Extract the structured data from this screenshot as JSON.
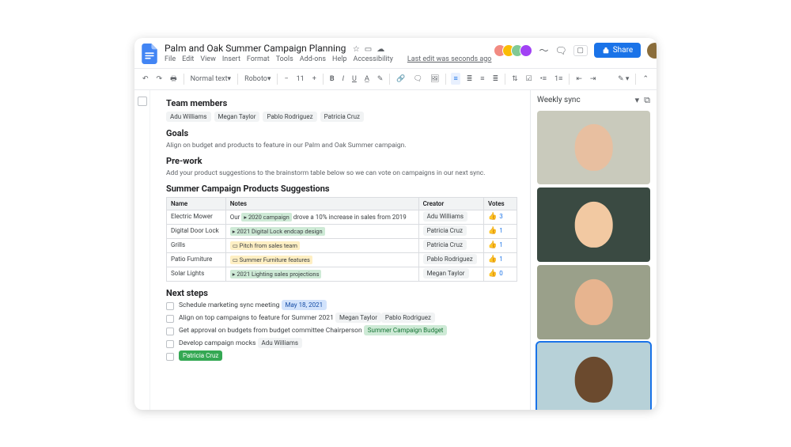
{
  "header": {
    "doc_title": "Palm and Oak Summer Campaign Planning",
    "menus": [
      "File",
      "Edit",
      "View",
      "Insert",
      "Format",
      "Tools",
      "Add-ons",
      "Help",
      "Accessibility"
    ],
    "last_edit": "Last edit was seconds ago",
    "share_label": "Share",
    "collaborator_colors": [
      "#f28b82",
      "#fbbc04",
      "#81c995",
      "#a142f4"
    ]
  },
  "toolbar": {
    "style": "Normal text",
    "font": "Roboto",
    "size": "11"
  },
  "doc": {
    "team_members_title": "Team members",
    "team_members": [
      "Adu Williams",
      "Megan Taylor",
      "Pablo Rodriguez",
      "Patricia Cruz"
    ],
    "goals_title": "Goals",
    "goals_text": "Align on budget and products to feature in our Palm and Oak Summer campaign.",
    "prework_title": "Pre-work",
    "prework_text": "Add your product suggestions to the brainstorm table below so we can vote on campaigns in our next sync.",
    "table_title": "Summer Campaign Products Suggestions",
    "columns": [
      "Name",
      "Notes",
      "Creator",
      "Votes"
    ],
    "rows": [
      {
        "name": "Electric Mower",
        "note_prefix": "Our ",
        "note_chip": "2020 campaign",
        "note_suffix": " drove a 10% increase in sales from 2019",
        "note_color": "g",
        "creator": "Adu Williams",
        "votes": "3"
      },
      {
        "name": "Digital Door Lock",
        "note_chip": "2021 Digital Lock endcap design",
        "note_color": "g",
        "creator": "Patricia Cruz",
        "votes": "1"
      },
      {
        "name": "Grills",
        "note_chip": "Pitch from sales team",
        "note_color": "y",
        "creator": "Patricia Cruz",
        "votes": "1"
      },
      {
        "name": "Patio Furniture",
        "note_chip": "Summer Furniture features",
        "note_color": "y",
        "creator": "Pablo Rodriguez",
        "votes": "1"
      },
      {
        "name": "Solar Lights",
        "note_chip": "2021 Lighting sales projections",
        "note_color": "g",
        "creator": "Megan Taylor",
        "votes": "0"
      }
    ],
    "next_steps_title": "Next steps",
    "steps": [
      {
        "text": "Schedule marketing sync meeting",
        "chips": [
          {
            "label": "May 18, 2021",
            "cls": "blue"
          }
        ]
      },
      {
        "text": "Align on top campaigns to feature for Summer 2021",
        "chips": [
          {
            "label": "Megan Taylor",
            "cls": ""
          },
          {
            "label": "Pablo Rodriguez",
            "cls": ""
          }
        ]
      },
      {
        "text": "Get approval on budgets from budget committee Chairperson",
        "chips": [
          {
            "label": "Summer Campaign Budget",
            "cls": "green"
          }
        ]
      },
      {
        "text": "Develop campaign mocks",
        "chips": [
          {
            "label": "Adu Williams",
            "cls": ""
          }
        ]
      },
      {
        "text": "",
        "chips": [
          {
            "label": "Patricia Cruz",
            "cls": "lightgreen"
          }
        ]
      }
    ]
  },
  "sidepanel": {
    "title": "Weekly sync",
    "tiles": [
      {
        "bg": "#c9cabc",
        "face": "#e8bfa0",
        "selected": false
      },
      {
        "bg": "#3a4a42",
        "face": "#f2c9a2",
        "selected": false
      },
      {
        "bg": "#9aa08a",
        "face": "#e7b48f",
        "selected": false
      },
      {
        "bg": "#b7d1d8",
        "face": "#6b4a2e",
        "selected": true
      }
    ]
  }
}
